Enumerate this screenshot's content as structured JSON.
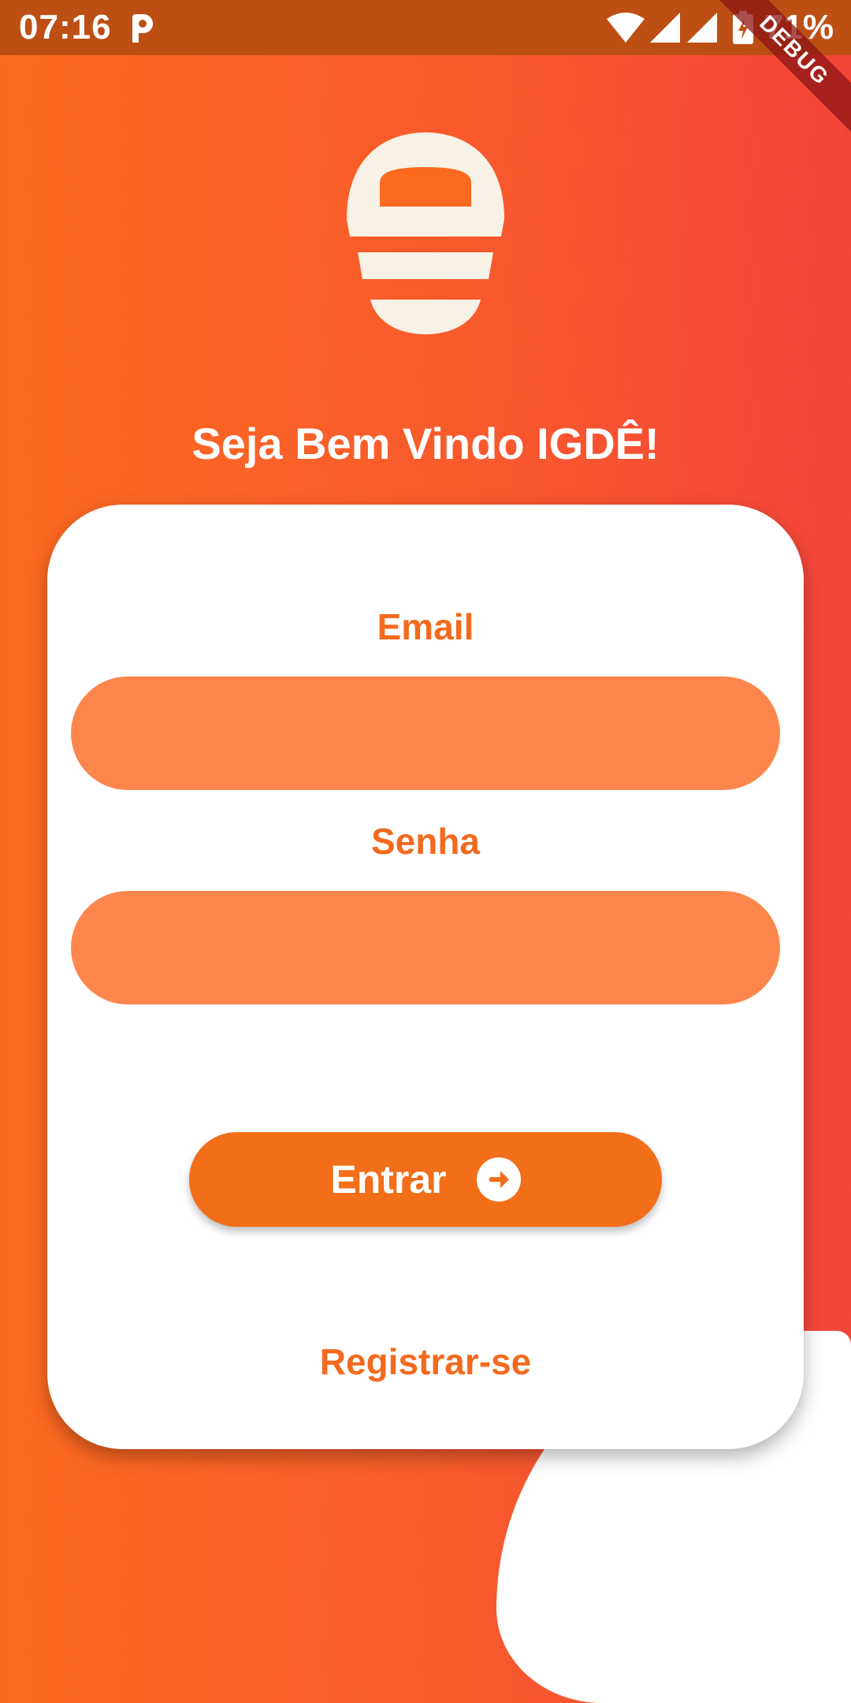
{
  "status_bar": {
    "time": "07:16",
    "battery": "71%",
    "app_icon": "p-letter-icon",
    "color": "#bd4f15"
  },
  "debug_banner": {
    "label": "DEBUG"
  },
  "logo": {
    "icon": "lightbulb-logo-icon",
    "color": "#f7f1e6"
  },
  "welcome": {
    "title": "Seja Bem Vindo IGDÊ!"
  },
  "login_form": {
    "email_label": "Email",
    "email_value": "",
    "senha_label": "Senha",
    "senha_value": "",
    "submit_label": "Entrar",
    "submit_icon": "arrow-right-circle-icon",
    "register_label": "Registrar-se"
  },
  "colors": {
    "accent": "#f26e18",
    "input_fill": "#fd864d",
    "gradient_start": "#fc6a1f",
    "gradient_end": "#f4453a"
  }
}
